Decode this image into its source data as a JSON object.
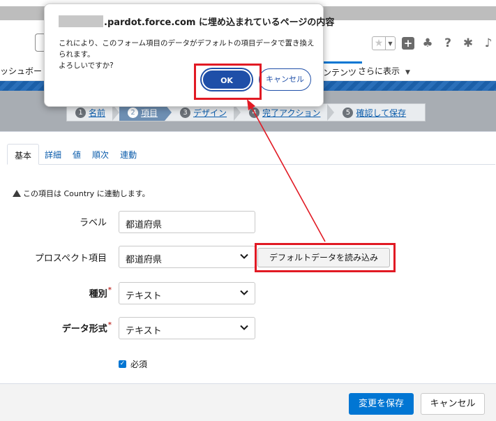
{
  "nav": {
    "left_text": "ッシュボード",
    "active_tab": "ンテンツ",
    "more": "さらに表示"
  },
  "steps": [
    {
      "num": "1",
      "label": "名前"
    },
    {
      "num": "2",
      "label": "項目"
    },
    {
      "num": "3",
      "label": "デザイン"
    },
    {
      "num": "4",
      "label": "完了アクション"
    },
    {
      "num": "5",
      "label": "確認して保存"
    }
  ],
  "tabs": [
    "基本",
    "詳細",
    "値",
    "順次",
    "連動"
  ],
  "warning": "この項目は Country に連動します。",
  "form": {
    "label_label": "ラベル",
    "label_value": "都道府県",
    "prospect_label": "プロスペクト項目",
    "prospect_value": "都道府県",
    "load_default": "デフォルトデータを読み込み",
    "type_label": "種別",
    "type_value": "テキスト",
    "format_label": "データ形式",
    "format_value": "テキスト",
    "required_label": "必須",
    "required_symbol": "*"
  },
  "footer": {
    "save": "変更を保存",
    "cancel": "キャンセル"
  },
  "dialog": {
    "title_suffix": ".pardot.force.com に埋め込まれているページの内容",
    "message_line1": "これにより、このフォーム項目のデータがデフォルトの項目データで置き換えられます。",
    "message_line2": "よろしいですか?",
    "ok": "OK",
    "cancel": "キャンセル"
  },
  "colors": {
    "highlight": "#e11a24",
    "primary": "#0176d3",
    "dialog_button": "#1f4fa8"
  }
}
